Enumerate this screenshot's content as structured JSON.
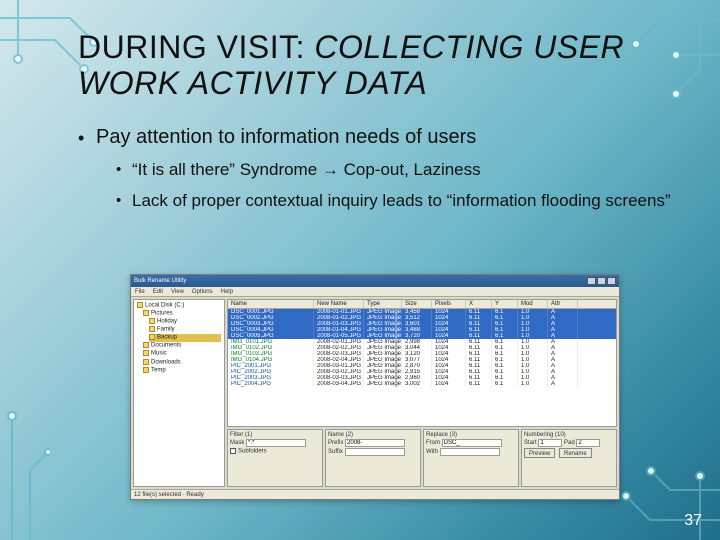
{
  "slide": {
    "title_plain": "DURING VISIT: ",
    "title_italic": "COLLECTING USER WORK ACTIVITY DATA",
    "bullet": "Pay attention to information needs of users",
    "sub1": "“It is all there” Syndrome → Cop-out, Laziness",
    "sub2": "Lack of proper contextual inquiry leads to “information flooding screens”",
    "pagenum": "37"
  },
  "app": {
    "title": "Bulk Rename Utility",
    "menu": [
      "File",
      "Edit",
      "View",
      "Options",
      "Help"
    ],
    "tree": [
      {
        "lvl": 0,
        "label": "Local Disk (C:)"
      },
      {
        "lvl": 1,
        "label": "Pictures"
      },
      {
        "lvl": 2,
        "label": "Holiday"
      },
      {
        "lvl": 2,
        "label": "Family"
      },
      {
        "lvl": 2,
        "label": "Backup",
        "sel": true
      },
      {
        "lvl": 1,
        "label": "Documents"
      },
      {
        "lvl": 1,
        "label": "Music"
      },
      {
        "lvl": 1,
        "label": "Downloads"
      },
      {
        "lvl": 1,
        "label": "Temp"
      }
    ],
    "columns": [
      "Name",
      "New Name",
      "Type",
      "Size",
      "Pixels",
      "X",
      "Y",
      "Mod",
      "Attr"
    ],
    "rows": [
      {
        "sel": true,
        "cells": [
          "DSC_0001.JPG",
          "2008-01-01.JPG",
          "JPEG Image",
          "3,458",
          "1024",
          "6.11",
          "6.1",
          "1.0",
          "A"
        ]
      },
      {
        "sel": true,
        "cells": [
          "DSC_0002.JPG",
          "2008-01-02.JPG",
          "JPEG Image",
          "3,512",
          "1024",
          "6.11",
          "6.1",
          "1.0",
          "A"
        ]
      },
      {
        "sel": true,
        "cells": [
          "DSC_0003.JPG",
          "2008-01-03.JPG",
          "JPEG Image",
          "3,601",
          "1024",
          "6.11",
          "6.1",
          "1.0",
          "A"
        ]
      },
      {
        "sel": true,
        "cells": [
          "DSC_0004.JPG",
          "2008-01-04.JPG",
          "JPEG Image",
          "3,488",
          "1024",
          "6.11",
          "6.1",
          "1.0",
          "A"
        ]
      },
      {
        "sel": true,
        "cells": [
          "DSC_0005.JPG",
          "2008-01-05.JPG",
          "JPEG Image",
          "3,720",
          "1024",
          "6.11",
          "6.1",
          "1.0",
          "A"
        ]
      },
      {
        "g": 1,
        "cells": [
          "IMG_0101.JPG",
          "2008-02-01.JPG",
          "JPEG Image",
          "2,998",
          "1024",
          "6.11",
          "6.1",
          "1.0",
          "A"
        ]
      },
      {
        "g": 1,
        "cells": [
          "IMG_0102.JPG",
          "2008-02-02.JPG",
          "JPEG Image",
          "3,044",
          "1024",
          "6.11",
          "6.1",
          "1.0",
          "A"
        ]
      },
      {
        "g": 1,
        "cells": [
          "IMG_0103.JPG",
          "2008-02-03.JPG",
          "JPEG Image",
          "3,120",
          "1024",
          "6.11",
          "6.1",
          "1.0",
          "A"
        ]
      },
      {
        "g": 1,
        "cells": [
          "IMG_0104.JPG",
          "2008-02-04.JPG",
          "JPEG Image",
          "3,077",
          "1024",
          "6.11",
          "6.1",
          "1.0",
          "A"
        ]
      },
      {
        "g": 2,
        "cells": [
          "PIC_2001.JPG",
          "2008-03-01.JPG",
          "JPEG Image",
          "2,870",
          "1024",
          "6.11",
          "6.1",
          "1.0",
          "A"
        ]
      },
      {
        "g": 2,
        "cells": [
          "PIC_2002.JPG",
          "2008-03-02.JPG",
          "JPEG Image",
          "2,915",
          "1024",
          "6.11",
          "6.1",
          "1.0",
          "A"
        ]
      },
      {
        "g": 2,
        "cells": [
          "PIC_2003.JPG",
          "2008-03-03.JPG",
          "JPEG Image",
          "2,960",
          "1024",
          "6.11",
          "6.1",
          "1.0",
          "A"
        ]
      },
      {
        "g": 2,
        "cells": [
          "PIC_2004.JPG",
          "2008-03-04.JPG",
          "JPEG Image",
          "3,002",
          "1024",
          "6.11",
          "6.1",
          "1.0",
          "A"
        ]
      }
    ],
    "panels": {
      "p1": {
        "title": "Filter (1)",
        "field1": "Mask",
        "val1": "*.*",
        "chk": "Subfolders"
      },
      "p2": {
        "title": "Name (2)",
        "field1": "Prefix",
        "val1": "2008-",
        "field2": "Suffix",
        "val2": ""
      },
      "p3": {
        "title": "Replace (3)",
        "field1": "From",
        "val1": "DSC_",
        "field2": "With",
        "val2": ""
      },
      "p4": {
        "title": "Numbering (10)",
        "field1": "Start",
        "val1": "1",
        "field2": "Pad",
        "val2": "2",
        "btn1": "Preview",
        "btn2": "Rename"
      }
    },
    "status": "12 file(s) selected · Ready"
  }
}
